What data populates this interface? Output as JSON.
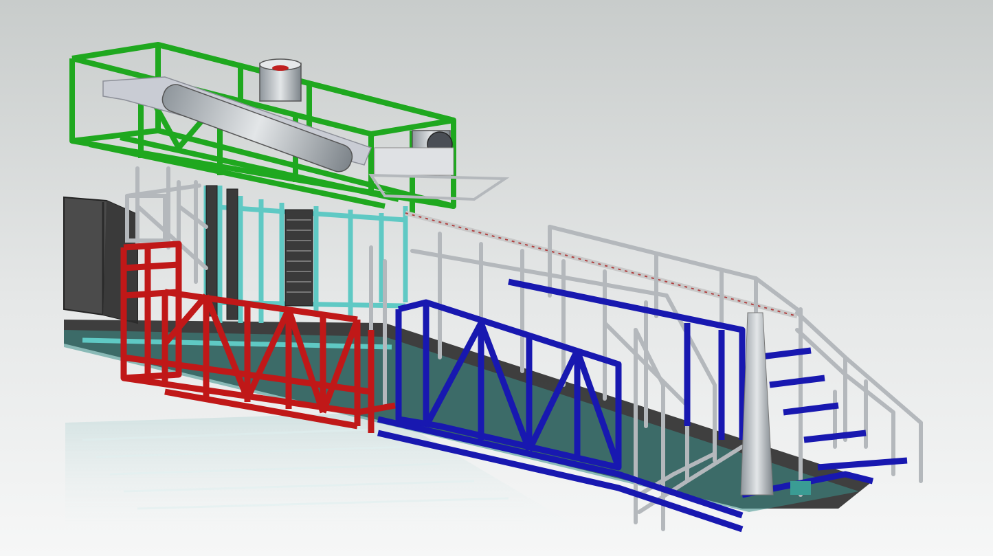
{
  "scene": {
    "kind": "cad-render",
    "colors": {
      "background_top": "#c9cdcc",
      "background_bottom": "#f4f5f5",
      "upper_frame": "#1fa81f",
      "lower_left_frame": "#c01818",
      "lower_right_frame": "#1818b0",
      "handrails": "#b4b8bc",
      "accent_structure": "#5fc9c4",
      "electrical_cabinet": "#4a4a4a",
      "base_rail": "#2a2a2a"
    },
    "icons": [
      "mechanical-assembly",
      "walkway-stairs"
    ]
  }
}
